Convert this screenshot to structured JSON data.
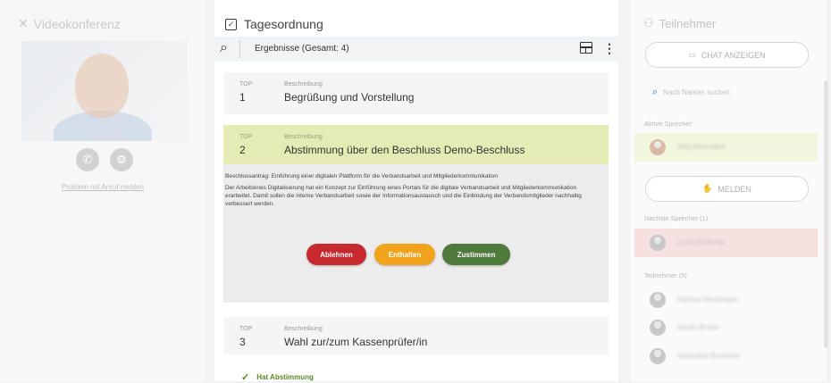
{
  "left": {
    "title": "Videokonferenz",
    "problem_link": "Problem mit Anruf melden"
  },
  "center": {
    "title": "Tagesordnung",
    "results_label": "Ergebnisse (Gesamt: 4)",
    "col_top": "TOP",
    "col_desc": "Beschreibung",
    "items": [
      {
        "num": "1",
        "text": "Begrüßung und Vorstellung"
      },
      {
        "num": "2",
        "text": "Abstimmung über den Beschluss Demo-Beschluss",
        "para1": "Beschlussantrag: Einführung einer digitalen Plattform für die Verbandsarbeit und Mitgliederkommunikation",
        "para2": "Der Arbeitskreis Digitalisierung hat ein Konzept zur Einführung eines Portals für die digitale Verbandsarbeit und Mitgliederkommunikation erarbeitet. Damit sollen die interne Verbandsarbeit sowie der Informationsaustausch und die Einbindung der Verbandsmitglieder nachhaltig verbessert werden."
      },
      {
        "num": "3",
        "text": "Wahl zur/zum Kassenprüfer/in"
      }
    ],
    "buttons": {
      "reject": "Ablehnen",
      "abstain": "Enthalten",
      "approve": "Zustimmen"
    },
    "colors": {
      "reject": "#c62a2f",
      "abstain": "#f0a31b",
      "approve": "#4e7a3c"
    },
    "has_vote": "Hat Abstimmung"
  },
  "right": {
    "title": "Teilnehmer",
    "chat_button": "CHAT ANZEIGEN",
    "search_placeholder": "Nach Namen suchen",
    "active_label": "Aktive Sprecher",
    "active_speaker": "Jörg Rosenthal",
    "raise_button": "MELDEN",
    "next_label": "Nächste Sprecher (1)",
    "next_speaker": "Luisa Schirmer",
    "participants_label": "Teilnehmer (5)",
    "participants": [
      "Markus Horstmann",
      "Martin Brown",
      "Sebastian Brummer"
    ]
  }
}
